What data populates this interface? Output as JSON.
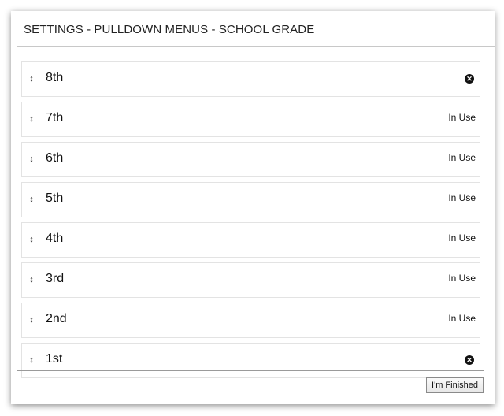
{
  "header": {
    "title": "SETTINGS - PULLDOWN MENUS - SCHOOL GRADE"
  },
  "items": [
    {
      "label": "8th",
      "status": "",
      "removable": true
    },
    {
      "label": "7th",
      "status": "In Use",
      "removable": false
    },
    {
      "label": "6th",
      "status": "In Use",
      "removable": false
    },
    {
      "label": "5th",
      "status": "In Use",
      "removable": false
    },
    {
      "label": "4th",
      "status": "In Use",
      "removable": false
    },
    {
      "label": "3rd",
      "status": "In Use",
      "removable": false
    },
    {
      "label": "2nd",
      "status": "In Use",
      "removable": false
    },
    {
      "label": "1st",
      "status": "",
      "removable": true
    }
  ],
  "icons": {
    "drag_handle": "↕",
    "remove": "✕"
  },
  "footer": {
    "finish_label": "I'm Finished"
  }
}
